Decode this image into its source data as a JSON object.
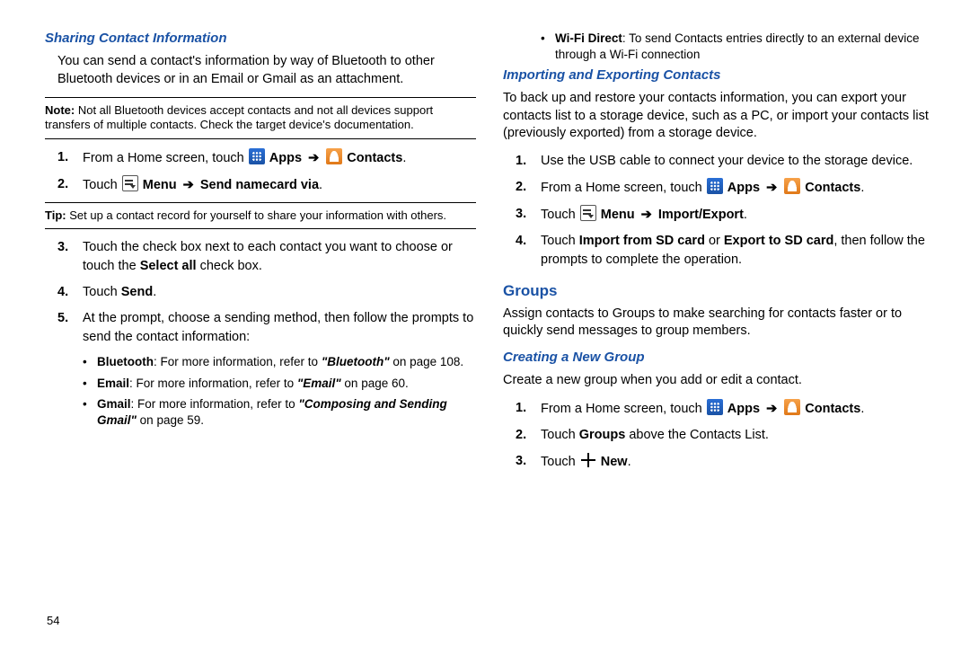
{
  "pageNumber": "54",
  "left": {
    "h1": "Sharing Contact Information",
    "intro": "You can send a contact's information by way of Bluetooth to other Bluetooth devices or in an Email or Gmail as an attachment.",
    "noteLabel": "Note:",
    "noteBody": "Not all Bluetooth devices accept contacts and not all devices support transfers of multiple contacts. Check the target device's documentation.",
    "step1_a": "From a Home screen, touch ",
    "apps": "Apps",
    "contacts": "Contacts",
    "step2_a": "Touch ",
    "menu": "Menu",
    "sendvia": "Send namecard via",
    "tipLabel": "Tip:",
    "tipBody": "Set up a contact record for yourself to share your information with others.",
    "step3_a": "Touch the check box next to each contact you want to choose or touch the ",
    "selectAll": "Select all",
    "step3_c": " check box.",
    "step4_a": "Touch ",
    "send": "Send",
    "step5": "At the prompt, choose a sending method, then follow the prompts to send the contact information:",
    "b1_a": "Bluetooth",
    "b1_b": ": For more information, refer to ",
    "b1_ref": "\"Bluetooth\"",
    "b1_c": " on page 108.",
    "b2_a": "Email",
    "b2_b": ": For more information, refer to ",
    "b2_ref": "\"Email\"",
    "b2_c": " on page 60.",
    "b3_a": "Gmail",
    "b3_b": ": For more information, refer to ",
    "b3_ref": "\"Composing and Sending Gmail\"",
    "b3_c": " on page 59."
  },
  "right": {
    "wifi_a": "Wi-Fi Direct",
    "wifi_b": ": To send Contacts entries directly to an external device through a Wi-Fi connection",
    "h2": "Importing and Exporting Contacts",
    "intro2": "To back up and restore your contacts information, you can export your contacts list to a storage device, such as a PC, or import your contacts list (previously exported) from a storage device.",
    "s1": "Use the USB cable to connect your device to the storage device.",
    "s2_a": "From a Home screen, touch ",
    "apps": "Apps",
    "contacts": "Contacts",
    "s3_a": "Touch ",
    "menu": "Menu",
    "impexp": "Import/Export",
    "s4_a": "Touch ",
    "s4_b": "Import from SD card",
    "s4_c": " or ",
    "s4_d": "Export to SD card",
    "s4_e": ", then follow the prompts to complete the operation.",
    "groupsHead": "Groups",
    "groupsIntro": "Assign contacts to Groups to make searching for contacts faster or to quickly send messages to group members.",
    "h3": "Creating a New Group",
    "h3intro": "Create a new group when you add or edit a contact.",
    "g1_a": "From a Home screen, touch ",
    "g2_a": "Touch ",
    "g2_b": "Groups",
    "g2_c": " above the Contacts List.",
    "g3_a": "Touch ",
    "new": "New"
  }
}
